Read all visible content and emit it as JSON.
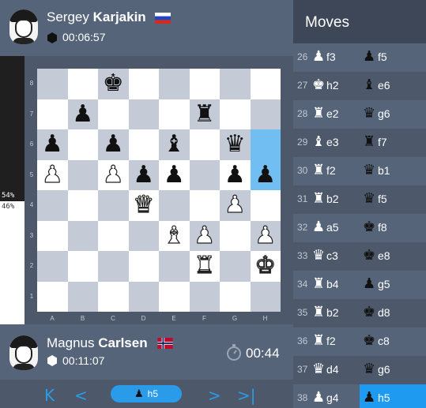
{
  "top_player": {
    "first_name": "Sergey",
    "last_name": "Karjakin",
    "time": "00:06:57",
    "flag": "russia"
  },
  "bottom_player": {
    "first_name": "Magnus",
    "last_name": "Carlsen",
    "time": "00:11:07",
    "flag": "norway",
    "move_timer": "00:44"
  },
  "eval": {
    "black_pct": "54%",
    "white_pct": "46%",
    "black_fraction": 0.54
  },
  "board": {
    "ranks": [
      "8",
      "7",
      "6",
      "5",
      "4",
      "3",
      "2",
      "1"
    ],
    "files": [
      "A",
      "B",
      "C",
      "D",
      "E",
      "F",
      "G",
      "H"
    ],
    "highlighted": [
      "h6",
      "h5"
    ],
    "pieces": {
      "c8": "bk",
      "b7": "bp",
      "f7": "br",
      "a6": "bp",
      "c6": "bp",
      "e6": "bb",
      "g6": "bq",
      "a5": "wp",
      "c5": "wp",
      "d5": "bp",
      "e5": "bp",
      "g5": "bp",
      "h5": "bp",
      "d4": "wq",
      "g4": "wp",
      "e3": "wb",
      "f3": "wp",
      "h3": "wp",
      "f2": "wr",
      "h2": "wk"
    }
  },
  "nav": {
    "first_icon": "first-move-icon",
    "prev_icon": "previous-move-icon",
    "current_move": "h5",
    "current_piece": "pawn",
    "next_icon": "next-move-icon",
    "last_icon": "last-move-icon"
  },
  "moves_panel": {
    "title": "Moves",
    "moves": [
      {
        "num": "26",
        "white_piece": "pawn",
        "white": "f3",
        "black_piece": "pawn",
        "black": "f5"
      },
      {
        "num": "27",
        "white_piece": "king",
        "white": "h2",
        "black_piece": "bishop",
        "black": "e6"
      },
      {
        "num": "28",
        "white_piece": "rook",
        "white": "e2",
        "black_piece": "queen",
        "black": "g6"
      },
      {
        "num": "29",
        "white_piece": "bishop",
        "white": "e3",
        "black_piece": "rook",
        "black": "f7"
      },
      {
        "num": "30",
        "white_piece": "rook",
        "white": "f2",
        "black_piece": "queen",
        "black": "b1"
      },
      {
        "num": "31",
        "white_piece": "rook",
        "white": "b2",
        "black_piece": "queen",
        "black": "f5"
      },
      {
        "num": "32",
        "white_piece": "pawn",
        "white": "a5",
        "black_piece": "king",
        "black": "f8"
      },
      {
        "num": "33",
        "white_piece": "queen",
        "white": "c3",
        "black_piece": "king",
        "black": "e8"
      },
      {
        "num": "34",
        "white_piece": "rook",
        "white": "b4",
        "black_piece": "pawn",
        "black": "g5"
      },
      {
        "num": "35",
        "white_piece": "rook",
        "white": "b2",
        "black_piece": "king",
        "black": "d8"
      },
      {
        "num": "36",
        "white_piece": "rook",
        "white": "f2",
        "black_piece": "king",
        "black": "c8"
      },
      {
        "num": "37",
        "white_piece": "queen",
        "white": "d4",
        "black_piece": "queen",
        "black": "g6"
      },
      {
        "num": "38",
        "white_piece": "pawn",
        "white": "g4",
        "black_piece": "pawn",
        "black": "h5",
        "active": true
      }
    ]
  },
  "colors": {
    "accent": "#1e9bf0",
    "highlight_square": "#71bff2",
    "dark_square": "#c4cad6",
    "light_square": "#ffffff"
  }
}
